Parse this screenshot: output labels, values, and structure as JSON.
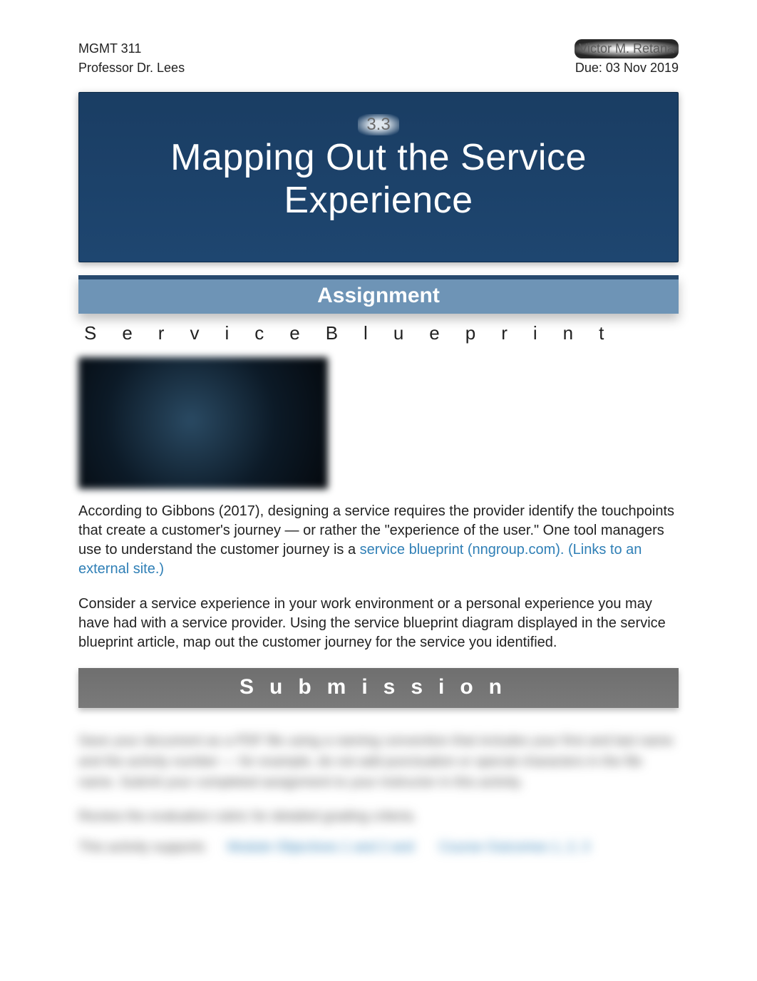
{
  "header": {
    "course": "MGMT 311",
    "professor": "Professor Dr. Lees",
    "student": "Victor M. Retana",
    "due": "Due: 03 Nov 2019"
  },
  "hero": {
    "number": "3.3",
    "title_line1": "Mapping Out the Service",
    "title_line2": "Experience"
  },
  "assignment_band": "Assignment",
  "subtitle_spaced": "ServiceBlueprint",
  "paragraph1_a": "According to Gibbons (2017), designing a service requires the provider identify the touchpoints that create a customer's journey — or rather the \"experience of the user.\" One tool managers use to understand the customer journey is a ",
  "paragraph1_link": "service blueprint (nngroup.com). (Links to an external site.)",
  "paragraph2": "Consider a service experience in your work environment or a personal experience you may have had with a service provider. Using the service blueprint diagram displayed in the service blueprint article, map out the customer journey for the service you identified.",
  "submission_band": "Submission",
  "blurred": {
    "p1": "Save your document as a PDF file using a naming convention that includes your first and last name and the activity number — for example, do not add punctuation or special characters in the file name. Submit your completed assignment to your instructor in this activity.",
    "p2": "Review the evaluation rubric for detailed grading criteria.",
    "label": "This activity supports",
    "link1": "Module Objectives 1 and 2 and",
    "link2": "Course Outcomes 1, 2, 3"
  }
}
